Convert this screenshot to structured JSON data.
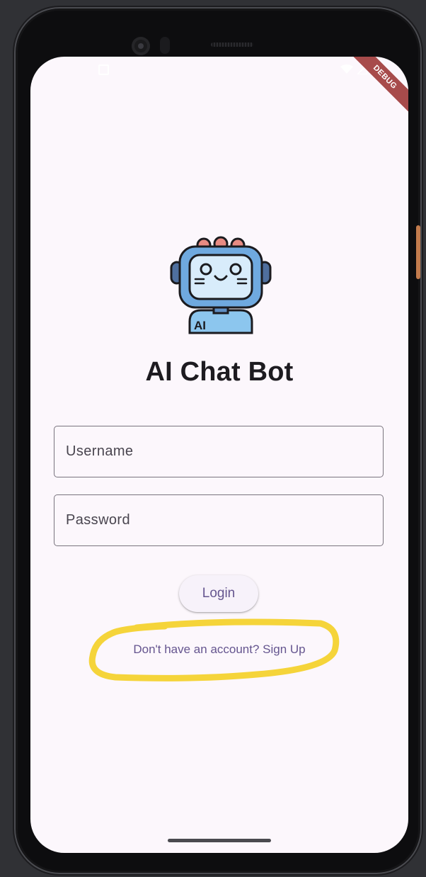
{
  "app": {
    "title": "AI Chat Bot",
    "logo_text": "AI"
  },
  "status_bar": {
    "debug_label": "DEBUG"
  },
  "login_form": {
    "username_placeholder": "Username",
    "password_placeholder": "Password",
    "login_label": "Login",
    "signup_label": "Don't have an account? Sign Up"
  },
  "colors": {
    "background": "#fcf7fc",
    "primary": "#65558f",
    "outline": "#79747e",
    "title": "#1d1b20",
    "highlight": "#f5d43a",
    "debug_banner": "#a74b4b"
  }
}
